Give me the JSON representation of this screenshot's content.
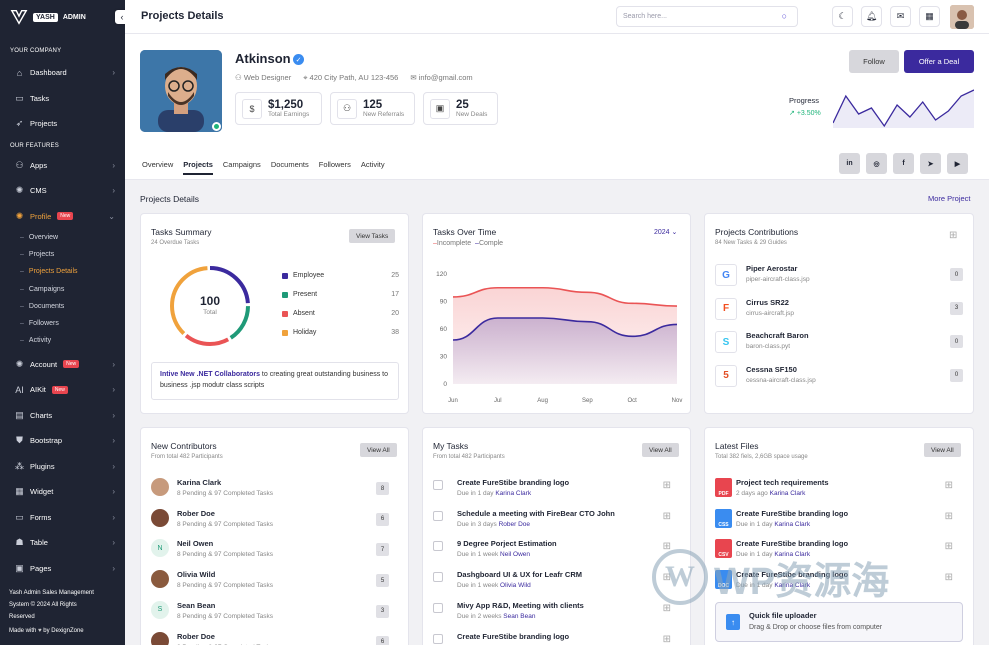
{
  "brand": {
    "name_box": "YASH",
    "name_text": "ADMIN"
  },
  "sidebar": {
    "section_company": "YOUR COMPANY",
    "section_features": "OUR FEATURES",
    "company_items": [
      {
        "label": "Dashboard",
        "icon": "home-icon"
      },
      {
        "label": "Tasks",
        "icon": "inbox-icon"
      },
      {
        "label": "Projects",
        "icon": "rocket-icon"
      }
    ],
    "feature_items_top": [
      {
        "label": "Apps",
        "icon": "users-icon"
      },
      {
        "label": "CMS",
        "icon": "cog-icon"
      },
      {
        "label": "Profile",
        "icon": "user-gear-icon",
        "badge": "New"
      }
    ],
    "profile_sub": [
      {
        "label": "Overview"
      },
      {
        "label": "Projects"
      },
      {
        "label": "Projects Details"
      },
      {
        "label": "Campaigns"
      },
      {
        "label": "Documents"
      },
      {
        "label": "Followers"
      },
      {
        "label": "Activity"
      }
    ],
    "feature_items_bottom": [
      {
        "label": "Account",
        "icon": "account-icon",
        "badge": "New"
      },
      {
        "label": "AIKit",
        "icon": "ai-icon",
        "badge": "New"
      },
      {
        "label": "Charts",
        "icon": "chart-icon"
      },
      {
        "label": "Bootstrap",
        "icon": "shield-icon"
      },
      {
        "label": "Plugins",
        "icon": "plugin-icon"
      },
      {
        "label": "Widget",
        "icon": "widget-icon"
      },
      {
        "label": "Forms",
        "icon": "forms-icon"
      },
      {
        "label": "Table",
        "icon": "table-icon"
      },
      {
        "label": "Pages",
        "icon": "pages-icon"
      }
    ],
    "footer_line1": "Yash Admin Sales Management",
    "footer_line2": "System © 2024 All Rights",
    "footer_line3": "Reserved",
    "footer_made": "Made with",
    "footer_by": "by DexignZone"
  },
  "topbar": {
    "title": "Projects Details",
    "search_placeholder": "Search here..."
  },
  "profile": {
    "name": "Atkinson",
    "role": "Web Designer",
    "location": "420 City Path, AU 123-456",
    "email": "info@gmail.com",
    "stats": [
      {
        "value": "$1,250",
        "label": "Total Earnings",
        "icon": "dollar-icon"
      },
      {
        "value": "125",
        "label": "New Referrals",
        "icon": "referrals-icon"
      },
      {
        "value": "25",
        "label": "New Deals",
        "icon": "briefcase-icon"
      }
    ],
    "follow": "Follow",
    "offer": "Offer a Deal",
    "progress_label": "Progress",
    "progress_value": "+3.50%",
    "progress_series": [
      12,
      30,
      18,
      22,
      10,
      24,
      16,
      26,
      14,
      20,
      30,
      34
    ],
    "tabs": [
      "Overview",
      "Projects",
      "Campaigns",
      "Documents",
      "Followers",
      "Activity"
    ],
    "social": [
      "in",
      "ig",
      "f",
      "tg",
      "yt"
    ]
  },
  "section": {
    "title": "Projects Details",
    "more": "More Project"
  },
  "tasks_summary": {
    "title": "Tasks Summary",
    "subtitle": "24 Overdue Tasks",
    "button": "View Tasks",
    "total_value": "100",
    "total_label": "Total",
    "legend": [
      {
        "label": "Employee",
        "value": "25",
        "color": "#3b2a9e"
      },
      {
        "label": "Present",
        "value": "17",
        "color": "#1f9a78"
      },
      {
        "label": "Absent",
        "value": "20",
        "color": "#ea5455"
      },
      {
        "label": "Holiday",
        "value": "38",
        "color": "#f0a23c"
      }
    ],
    "notice_bold": "Intive New .NET Collaborators",
    "notice_rest": "to creating great outstanding business to business .jsp modutr class scripts"
  },
  "chart_data": {
    "type": "area",
    "title": "Tasks Over Time",
    "year": "2024",
    "categories": [
      "Jun",
      "Jul",
      "Aug",
      "Sep",
      "Oct",
      "Nov"
    ],
    "ylim": [
      0,
      120
    ],
    "yticks": [
      0,
      30,
      60,
      90,
      120
    ],
    "series": [
      {
        "name": "Incomplete",
        "color": "#ea5455",
        "values": [
          95,
          105,
          105,
          100,
          88,
          85
        ]
      },
      {
        "name": "Comple",
        "color": "#3b2a9e",
        "values": [
          48,
          72,
          72,
          68,
          52,
          65
        ]
      }
    ]
  },
  "contributions": {
    "title": "Projects Contributions",
    "subtitle": "84 New Tasks & 29 Guides",
    "items": [
      {
        "name": "Piper Aerostar",
        "sub": "piper-aircraft-class.jsp",
        "count": "0",
        "logo": "G",
        "color": "#4285f4"
      },
      {
        "name": "Cirrus SR22",
        "sub": "cirrus-aircraft.jsp",
        "count": "3",
        "logo": "F",
        "color": "#f24e1e"
      },
      {
        "name": "Beachcraft Baron",
        "sub": "baron-class.pyt",
        "count": "0",
        "logo": "S",
        "color": "#36c5f0"
      },
      {
        "name": "Cessna SF150",
        "sub": "cessna-aircraft-class.jsp",
        "count": "0",
        "logo": "5",
        "color": "#e34f26"
      }
    ]
  },
  "contributors": {
    "title": "New Contributors",
    "subtitle": "From total 482 Participants",
    "button": "View All",
    "items": [
      {
        "name": "Karina Clark",
        "sub": "8 Pending & 97 Completed Tasks",
        "count": "8",
        "initial": ""
      },
      {
        "name": "Rober Doe",
        "sub": "8 Pending & 97 Completed Tasks",
        "count": "6",
        "initial": ""
      },
      {
        "name": "Neil Owen",
        "sub": "8 Pending & 97 Completed Tasks",
        "count": "7",
        "initial": "N"
      },
      {
        "name": "Olivia Wild",
        "sub": "8 Pending & 97 Completed Tasks",
        "count": "5",
        "initial": ""
      },
      {
        "name": "Sean Bean",
        "sub": "8 Pending & 97 Completed Tasks",
        "count": "3",
        "initial": "S"
      },
      {
        "name": "Rober Doe",
        "sub": "8 Pending & 97 Completed Tasks",
        "count": "6",
        "initial": ""
      }
    ]
  },
  "my_tasks": {
    "title": "My Tasks",
    "subtitle": "From total 482 Participants",
    "button": "View All",
    "items": [
      {
        "name": "Create FureStibe branding logo",
        "due": "Due in 1 day",
        "who": "Karina Clark"
      },
      {
        "name": "Schedule a meeting with FireBear CTO John",
        "due": "Due in 3 days",
        "who": "Rober Doe"
      },
      {
        "name": "9 Degree Porject Estimation",
        "due": "Due in 1 week",
        "who": "Neil Owen"
      },
      {
        "name": "Dashgboard UI & UX for Leafr CRM",
        "due": "Due in 1 week",
        "who": "Olivia Wild"
      },
      {
        "name": "Mivy App R&D, Meeting with clients",
        "due": "Due in 2 weeks",
        "who": "Sean Bean"
      },
      {
        "name": "Create FureStibe branding logo",
        "due": "",
        "who": ""
      }
    ]
  },
  "latest_files": {
    "title": "Latest Files",
    "subtitle": "Total 382 fiels, 2,6GB space usage",
    "button": "View All",
    "items": [
      {
        "name": "Project tech requirements",
        "due": "2 days ago",
        "who": "Karina Clark",
        "type": "PDF",
        "color": "#e8454f"
      },
      {
        "name": "Create FureStibe branding logo",
        "due": "Due in 1 day",
        "who": "Karina Clark",
        "type": "CSS",
        "color": "#3a8cf0"
      },
      {
        "name": "Create FureStibe branding logo",
        "due": "Due in 1 day",
        "who": "Karina Clark",
        "type": "CSV",
        "color": "#e8454f"
      },
      {
        "name": "Create FureStibe branding logo",
        "due": "Due in 1 day",
        "who": "Karina Clark",
        "type": "DOC",
        "color": "#3a8cf0"
      }
    ],
    "uploader_title": "Quick file uploader",
    "uploader_sub": "Drag & Drop or choose files from computer"
  },
  "watermark": {
    "letter": "W",
    "text": "WP资源海"
  }
}
